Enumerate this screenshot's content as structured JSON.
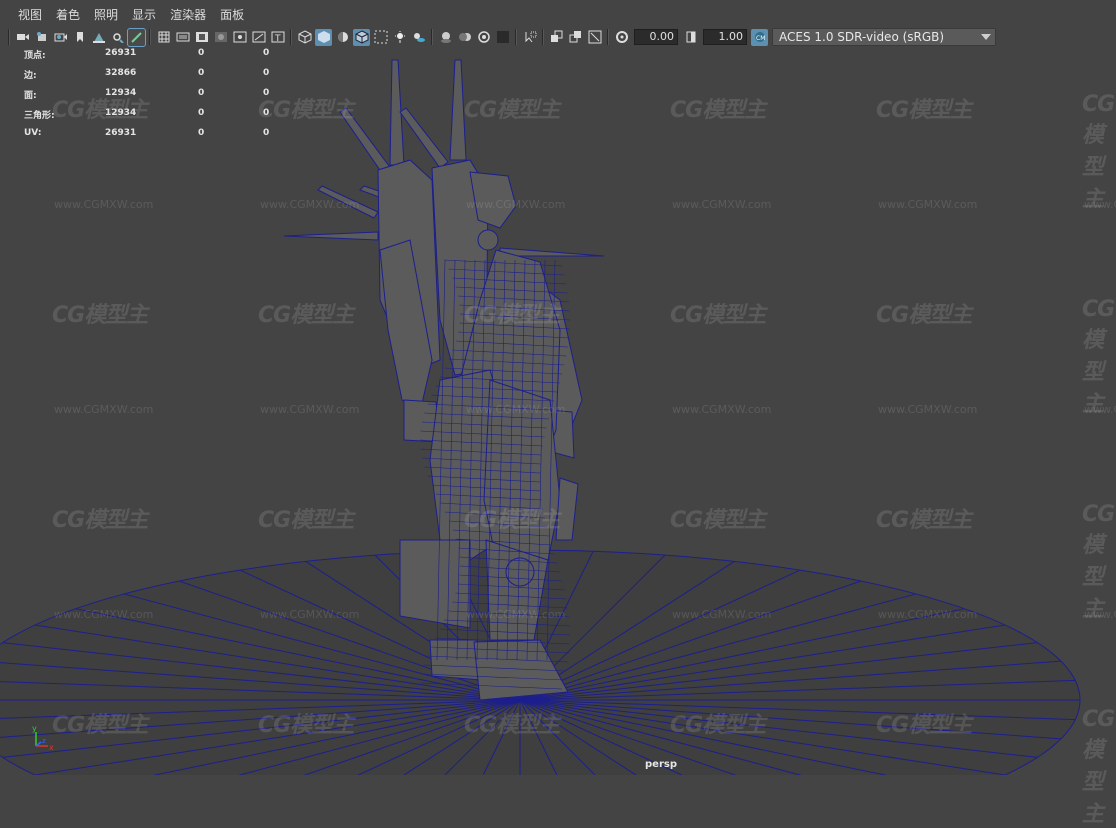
{
  "menu": [
    "视图",
    "着色",
    "照明",
    "显示",
    "渲染器",
    "面板"
  ],
  "toolbar": {
    "exposure_value": "0.00",
    "gamma_value": "1.00",
    "color_space": "ACES 1.0 SDR-video (sRGB)",
    "icons": [
      "select-camera-icon",
      "camera-attributes-icon",
      "bookmark-icon",
      "image-plane-icon",
      "grease-pencil-icon",
      "2d-pan-zoom-icon",
      "grid-icon",
      "film-gate-icon",
      "resolution-gate-icon",
      "gate-mask-icon",
      "field-chart-icon",
      "safe-action-icon",
      "safe-title-icon",
      "wireframe-icon",
      "smooth-shade-icon",
      "default-material-icon",
      "wireframe-on-shaded-icon",
      "xray-icon",
      "use-all-lights-icon",
      "shadows-icon",
      "ambient-occlusion-icon",
      "motion-blur-icon",
      "anti-aliasing-icon",
      "depth-of-field-icon",
      "isolate-select-icon",
      "xray-joints-icon",
      "xray-active-icon",
      "camera-frame-icon",
      "exposure-icon",
      "gamma-icon",
      "color-management-icon"
    ]
  },
  "hud": [
    {
      "label": "顶点:",
      "v1": "26931",
      "v2": "0",
      "v3": "0"
    },
    {
      "label": "边:",
      "v1": "32866",
      "v2": "0",
      "v3": "0"
    },
    {
      "label": "面:",
      "v1": "12934",
      "v2": "0",
      "v3": "0"
    },
    {
      "label": "三角形:",
      "v1": "12934",
      "v2": "0",
      "v3": "0"
    },
    {
      "label": "UV:",
      "v1": "26931",
      "v2": "0",
      "v3": "0"
    }
  ],
  "viewport": {
    "camera_label": "persp",
    "watermark_logo": "CG模型主",
    "watermark_url": "www.CGMXW.com",
    "wire_color": "#1c1f8c",
    "axis_labels": {
      "y": "y",
      "x": "x",
      "z": "z"
    }
  }
}
